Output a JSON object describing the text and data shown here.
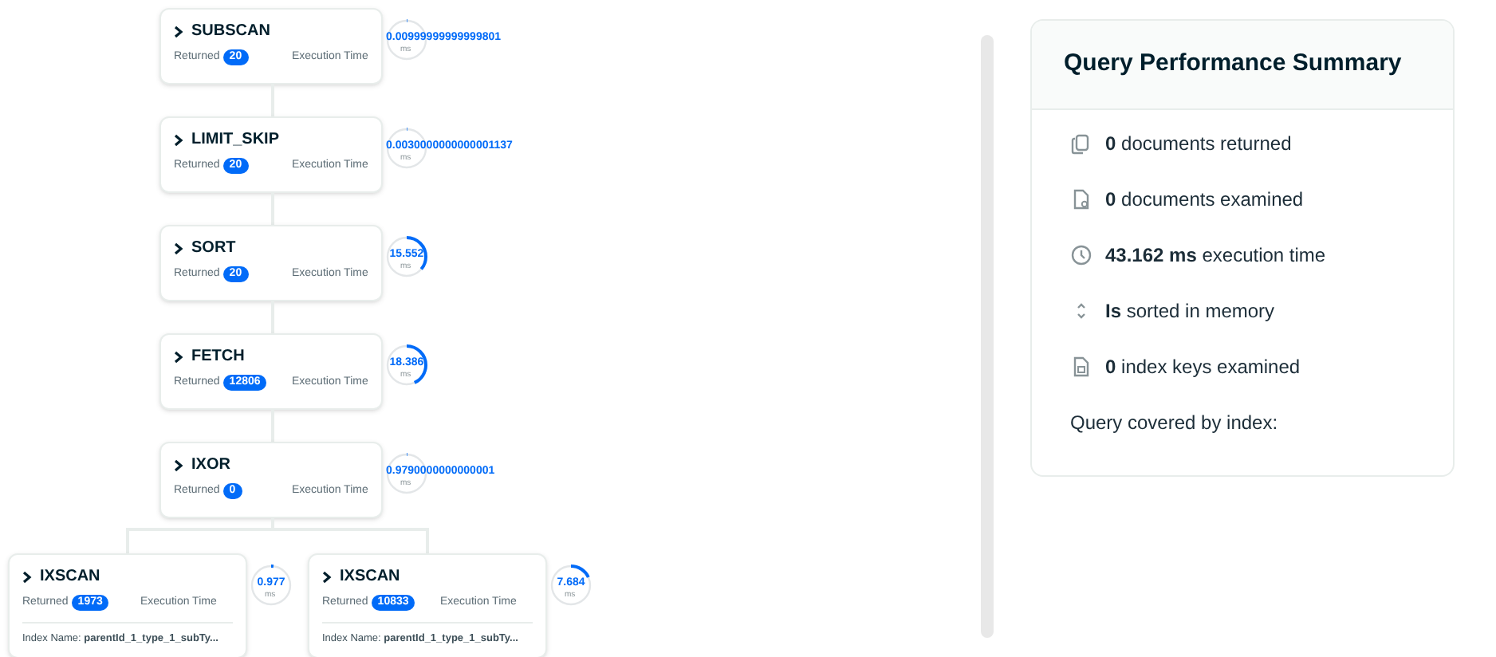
{
  "plan": {
    "stage": "SUBSCAN",
    "returned_label": "Returned",
    "returned": "20",
    "time_label": "Execution Time",
    "time": "0.00999999999999801",
    "unit": "ms",
    "level": 0.0,
    "children": [
      {
        "stage": "LIMIT_SKIP",
        "returned_label": "Returned",
        "returned": "20",
        "time_label": "Execution Time",
        "time": "0.0030000000000001137",
        "unit": "ms",
        "level": 0.0,
        "children": [
          {
            "stage": "SORT",
            "returned_label": "Returned",
            "returned": "20",
            "time_label": "Execution Time",
            "time": "15.552",
            "unit": "ms",
            "level": 0.36,
            "children": [
              {
                "stage": "FETCH",
                "returned_label": "Returned",
                "returned": "12806",
                "time_label": "Execution Time",
                "time": "18.386",
                "unit": "ms",
                "level": 0.43,
                "children": [
                  {
                    "stage": "IXOR",
                    "returned_label": "Returned",
                    "returned": "0",
                    "time_label": "Execution Time",
                    "time": "0.9790000000000001",
                    "unit": "ms",
                    "level": 0.0,
                    "children": [
                      {
                        "stage": "IXSCAN",
                        "returned_label": "Returned",
                        "returned": "1973",
                        "time_label": "Execution Time",
                        "time": "0.977",
                        "unit": "ms",
                        "level": 0.02,
                        "index_label": "Index Name:",
                        "index_name": "parentId_1_type_1_subTy..."
                      },
                      {
                        "stage": "IXSCAN",
                        "returned_label": "Returned",
                        "returned": "10833",
                        "time_label": "Execution Time",
                        "time": "7.684",
                        "unit": "ms",
                        "level": 0.18,
                        "index_label": "Index Name:",
                        "index_name": "parentId_1_type_1_subTy..."
                      }
                    ]
                  }
                ]
              }
            ]
          }
        ]
      }
    ]
  },
  "summary": {
    "title": "Query Performance Summary",
    "items": [
      {
        "kind": "copy",
        "text": "**0** documents returned"
      },
      {
        "kind": "doc-search",
        "text": "**0** documents examined"
      },
      {
        "kind": "clock",
        "text": "**43.162 ms** execution time"
      },
      {
        "kind": "sort",
        "text": "**Is** sorted in memory"
      },
      {
        "kind": "doc",
        "text": "**0** index keys examined"
      }
    ],
    "covered_label": "Query covered by index:"
  }
}
